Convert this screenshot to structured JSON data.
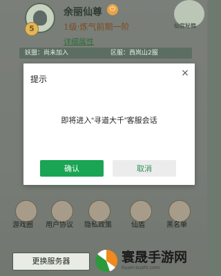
{
  "player": {
    "name": "余丽仙尊",
    "realm": "1级·炼气前期一阶",
    "level_badge": "5",
    "details_link": "详细属性",
    "faction_label": "妖盟：尚未加入",
    "region_label": "区服：西岚山2服"
  },
  "top_right": {
    "label": "仙宫秘籍"
  },
  "features": [
    {
      "label": "游戏圈",
      "icon": "game-circle-icon"
    },
    {
      "label": "用户协议",
      "icon": "user-agreement-icon"
    },
    {
      "label": "隐私政策",
      "icon": "privacy-policy-icon"
    },
    {
      "label": "仙盾",
      "icon": "shield-icon"
    },
    {
      "label": "黑名单",
      "icon": "blacklist-icon"
    }
  ],
  "footer": {
    "server_button": "更换服务器"
  },
  "watermark": {
    "title": "寰晟手游网",
    "url": "huan-sushi.com"
  },
  "dialog": {
    "title": "提示",
    "close_symbol": "×",
    "message": "即将进入“寻道大千”客服会话",
    "confirm_label": "确认",
    "cancel_label": "取消"
  },
  "colors": {
    "confirm_green": "#1aa554",
    "cancel_text_green": "#2f8f55"
  }
}
